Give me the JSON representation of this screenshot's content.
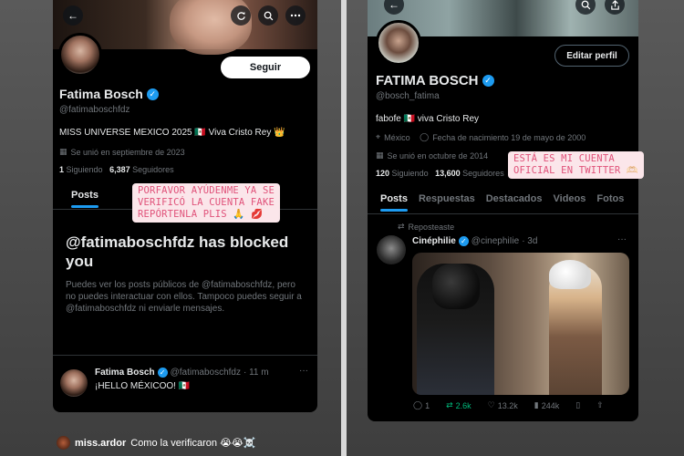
{
  "left": {
    "tweet_back": "←",
    "follow_label": "Seguir",
    "name": "Fatima Bosch",
    "handle": "@fatimaboschfdz",
    "bio": "MISS UNIVERSE MEXICO 2025 🇲🇽 Viva Cristo Rey 👑",
    "joined": "Se unió en septiembre de 2023",
    "following_count": "1",
    "following_label": "Siguiendo",
    "followers_count": "6,387",
    "followers_label": "Seguidores",
    "tab_posts": "Posts",
    "tab_partial": "R",
    "sticker_lines": [
      "PORFAVOR AYÚDENME YA SE",
      "VERIFICÓ LA CUENTA FAKE",
      "REPÓRTENLA PLIS 🙏 💋"
    ],
    "blocked_title": "@fatimaboschfdz has blocked you",
    "blocked_desc": "Puedes ver los posts públicos de @fatimaboschfdz, pero no puedes interactuar con ellos. Tampoco puedes seguir a @fatimaboschfdz ni enviarle mensajes.",
    "tweet": {
      "name": "Fatima Bosch",
      "handle": "@fatimaboschfdz",
      "time": "· 11 m",
      "text": "¡HELLO MÉXICOO! 🇲🇽",
      "more": "···"
    }
  },
  "right": {
    "edit_label": "Editar perfil",
    "name": "FATIMA BOSCH",
    "handle": "@bosch_fatima",
    "bio": "fabofe 🇲🇽 viva Cristo Rey",
    "location": "México",
    "birthday": "Fecha de nacimiento 19 de mayo de 2000",
    "joined": "Se unió en octubre de 2014",
    "following_count": "120",
    "following_label": "Siguiendo",
    "followers_count": "13,600",
    "followers_label": "Seguidores",
    "sticker_lines": [
      "ESTÁ ES MI CUENTA",
      "OFICIAL EN TWITTER 🫶🏻"
    ],
    "tabs": [
      "Posts",
      "Respuestas",
      "Destacados",
      "Videos",
      "Fotos"
    ],
    "reposted": "Reposteaste",
    "tweet": {
      "name": "Cinéphilie",
      "handle": "@cinephiIie",
      "time": "· 3d",
      "more": "···",
      "replies": "1",
      "reposts": "2.6k",
      "likes": "13.2k",
      "views": "244k"
    }
  },
  "comment": {
    "user": "miss.ardor",
    "text": "Como la verificaron 😭😭☠️"
  },
  "colors": {
    "background": "#000000",
    "accent": "#1d9bf0",
    "sticker_bg": "#fbe6ea",
    "sticker_text": "#e0527a",
    "repost_green": "#00ba7c"
  },
  "icons": [
    "back-arrow-icon",
    "refresh-icon",
    "search-icon",
    "more-icon",
    "share-icon",
    "verified-icon",
    "calendar-icon",
    "location-icon",
    "balloon-icon",
    "repost-icon",
    "reply-icon",
    "like-icon",
    "views-icon",
    "bookmark-icon"
  ]
}
